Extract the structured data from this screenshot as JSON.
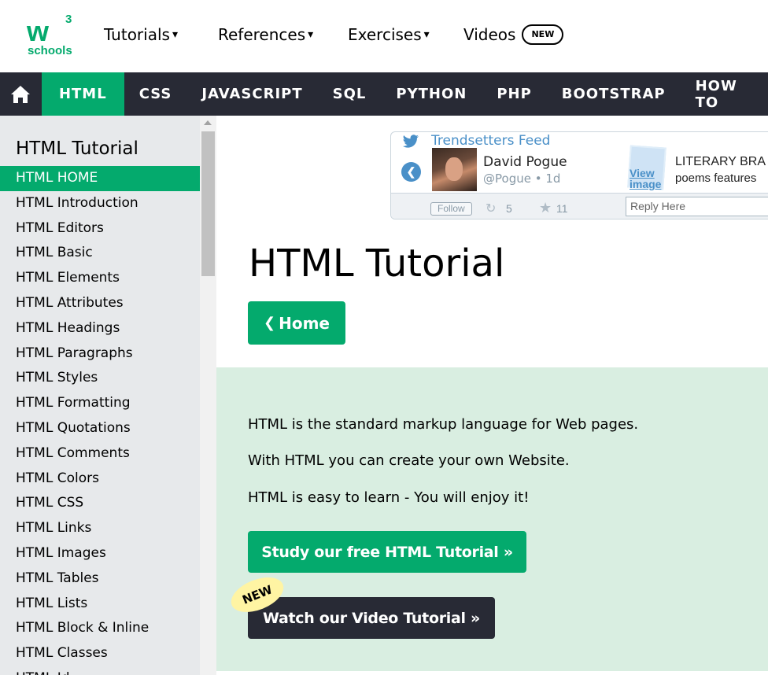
{
  "logo": {
    "mark": "w",
    "superscript": "3",
    "wordmark": "schools"
  },
  "top_nav": [
    {
      "label": "Tutorials",
      "caret": "▾"
    },
    {
      "label": "References",
      "caret": "▾"
    },
    {
      "label": "Exercises",
      "caret": "▾"
    },
    {
      "label": "Videos",
      "badge": "NEW"
    }
  ],
  "dark_nav": {
    "home_icon": "home-icon",
    "items": [
      "HTML",
      "CSS",
      "JAVASCRIPT",
      "SQL",
      "PYTHON",
      "PHP",
      "BOOTSTRAP",
      "HOW TO"
    ],
    "active": "HTML"
  },
  "sidebar": {
    "title": "HTML Tutorial",
    "items": [
      "HTML HOME",
      "HTML Introduction",
      "HTML Editors",
      "HTML Basic",
      "HTML Elements",
      "HTML Attributes",
      "HTML Headings",
      "HTML Paragraphs",
      "HTML Styles",
      "HTML Formatting",
      "HTML Quotations",
      "HTML Comments",
      "HTML Colors",
      "HTML CSS",
      "HTML Links",
      "HTML Images",
      "HTML Tables",
      "HTML Lists",
      "HTML Block & Inline",
      "HTML Classes",
      "HTML Id"
    ],
    "active": "HTML HOME"
  },
  "twitter": {
    "feed_title": "Trendsetters Feed",
    "author_name": "David Pogue",
    "author_handle": "@Pogue • 1d",
    "view_image": "View image",
    "tweet_line1": "LITERARY BRA",
    "tweet_line2": "poems features",
    "follow": "Follow",
    "retweets": "5",
    "favorites": "11",
    "reply_placeholder": "Reply Here"
  },
  "main": {
    "title": "HTML Tutorial",
    "home_button": "Home",
    "intro": [
      "HTML is the standard markup language for Web pages.",
      "With HTML you can create your own Website.",
      "HTML is easy to learn - You will enjoy it!"
    ],
    "study_button": "Study our free HTML Tutorial »",
    "video_button": "Watch our Video Tutorial »",
    "new_badge": "NEW"
  },
  "colors": {
    "brand_green": "#04aa6d",
    "dark": "#282a35",
    "intro_bg": "#d9eee1",
    "sidebar_bg": "#e7e9eb"
  }
}
